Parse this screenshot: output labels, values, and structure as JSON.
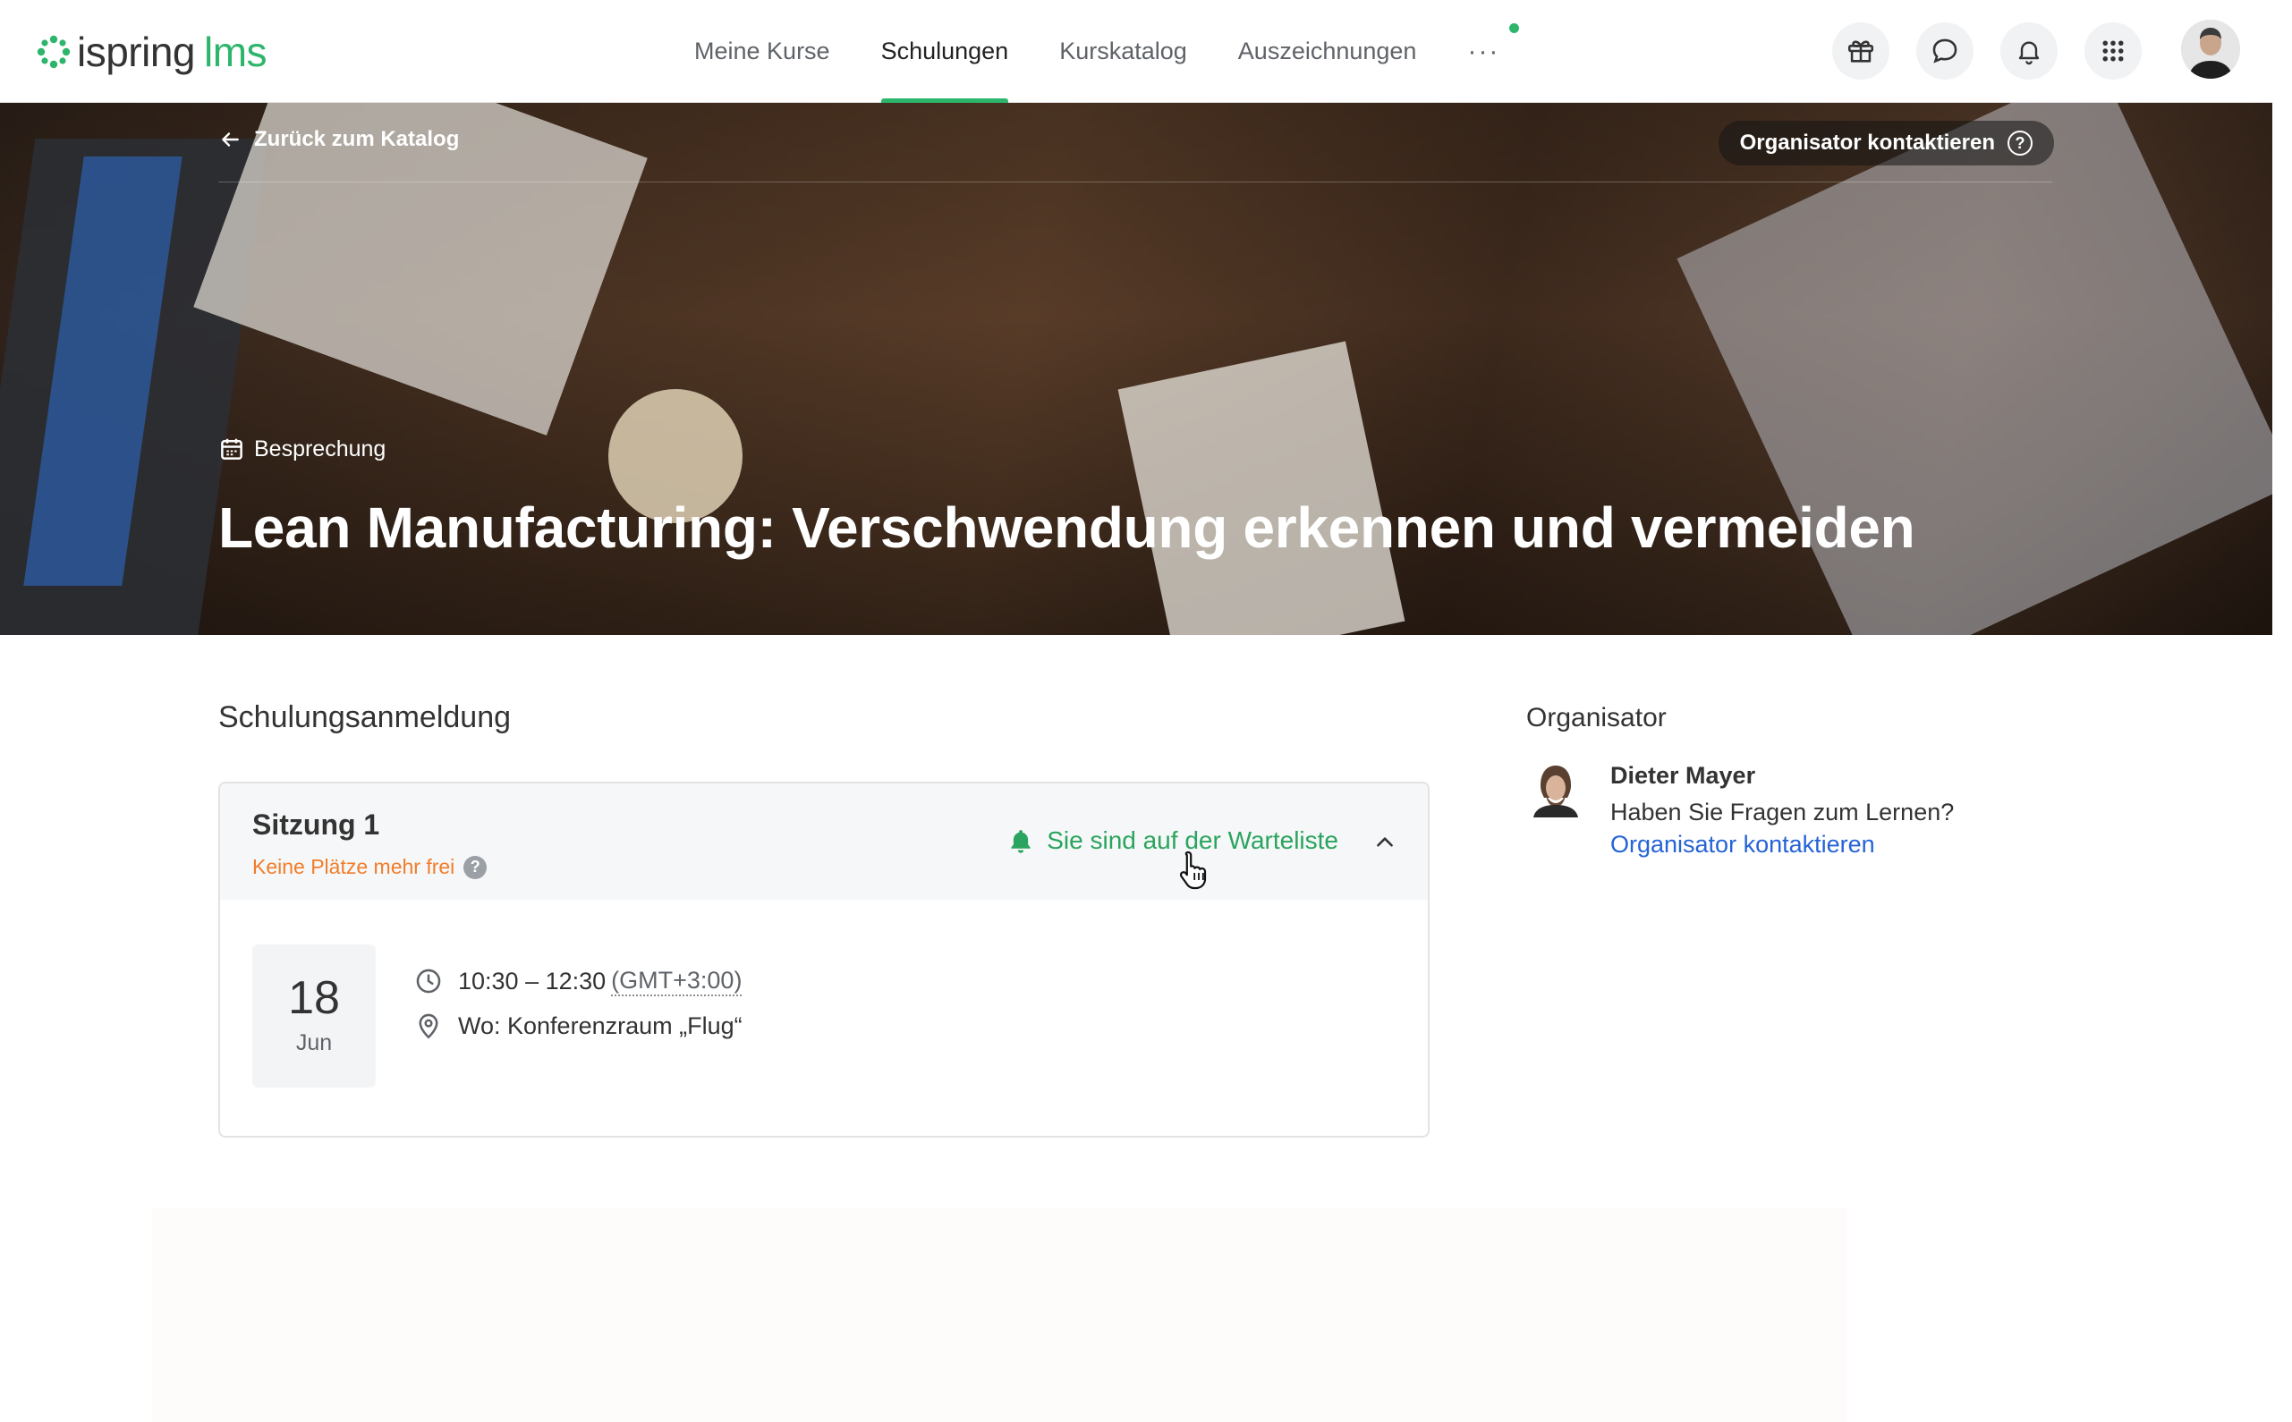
{
  "header": {
    "logo": {
      "brand": "ispring",
      "product": "lms"
    },
    "nav": [
      {
        "label": "Meine Kurse",
        "active": false
      },
      {
        "label": "Schulungen",
        "active": true
      },
      {
        "label": "Kurskatalog",
        "active": false
      },
      {
        "label": "Auszeichnungen",
        "active": false
      }
    ],
    "more_label": "···",
    "icons": [
      "gift-icon",
      "chat-icon",
      "bell-icon",
      "apps-grid-icon"
    ],
    "accent_color": "#2db56b"
  },
  "hero": {
    "back_label": "Zurück zum Katalog",
    "contact_label": "Organisator kontaktieren",
    "contact_help": "?",
    "type_label": "Besprechung",
    "title": "Lean Manufacturing: Verschwendung erkennen und vermeiden"
  },
  "registration": {
    "title": "Schulungsanmeldung",
    "session": {
      "name": "Sitzung 1",
      "status": "Keine Plätze mehr frei",
      "status_help": "?",
      "waitlist_label": "Sie sind auf der Warteliste",
      "date_day": "18",
      "date_month": "Jun",
      "time": "10:30 – 12:30",
      "timezone": "(GMT+3:00)",
      "location": "Wo: Konferenzraum „Flug“"
    },
    "status_color": "#f07d2a",
    "waitlist_color": "#2aa45e"
  },
  "organizer": {
    "title": "Organisator",
    "name": "Dieter Mayer",
    "question": "Haben Sie Fragen zum Lernen?",
    "link_label": "Organisator kontaktieren",
    "link_color": "#2563d6"
  }
}
